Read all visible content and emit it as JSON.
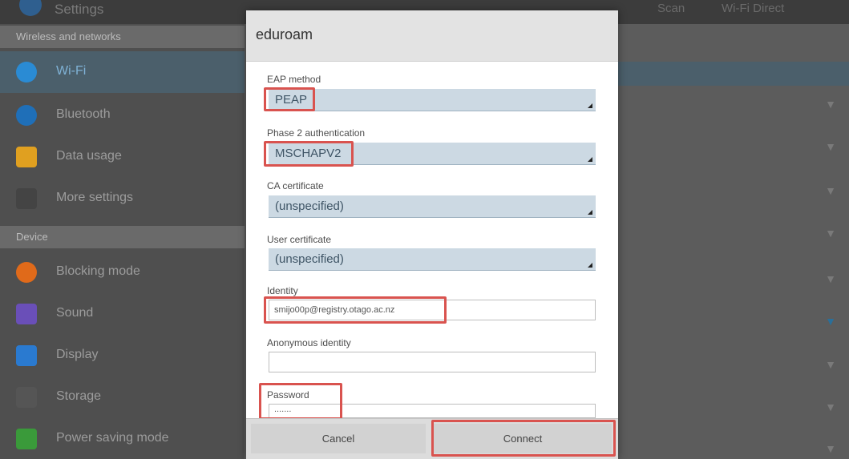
{
  "topbar": {
    "title": "Settings",
    "scan": "Scan",
    "wifi_direct": "Wi-Fi Direct"
  },
  "sidebar": {
    "sections": [
      {
        "label": "Wireless and networks"
      },
      {
        "label": "Device"
      }
    ],
    "items": [
      {
        "label": "Wi-Fi",
        "icon": "wifi-icon",
        "color": "#2a8bd4"
      },
      {
        "label": "Bluetooth",
        "icon": "bluetooth-icon",
        "color": "#1f6fb8"
      },
      {
        "label": "Data usage",
        "icon": "data-usage-icon",
        "color": "#e0a020"
      },
      {
        "label": "More settings",
        "icon": "more-icon",
        "color": "#444444"
      },
      {
        "label": "Blocking mode",
        "icon": "blocking-icon",
        "color": "#e06a1a"
      },
      {
        "label": "Sound",
        "icon": "sound-icon",
        "color": "#6a4fb8"
      },
      {
        "label": "Display",
        "icon": "display-icon",
        "color": "#2a7ad0"
      },
      {
        "label": "Storage",
        "icon": "storage-icon",
        "color": "#555555"
      },
      {
        "label": "Power saving mode",
        "icon": "power-saving-icon",
        "color": "#3a9a3a"
      }
    ]
  },
  "dialog": {
    "title": "eduroam",
    "eap_method": {
      "label": "EAP method",
      "value": "PEAP"
    },
    "phase2": {
      "label": "Phase 2 authentication",
      "value": "MSCHAPV2"
    },
    "ca_cert": {
      "label": "CA certificate",
      "value": "(unspecified)"
    },
    "user_cert": {
      "label": "User certificate",
      "value": "(unspecified)"
    },
    "identity": {
      "label": "Identity",
      "value": "smijo00p@registry.otago.ac.nz"
    },
    "anonymous": {
      "label": "Anonymous identity",
      "value": ""
    },
    "password": {
      "label": "Password",
      "value": "......."
    },
    "cancel_label": "Cancel",
    "connect_label": "Connect"
  },
  "colors": {
    "highlight": "#d9534f",
    "accent": "#2a8bd4"
  }
}
